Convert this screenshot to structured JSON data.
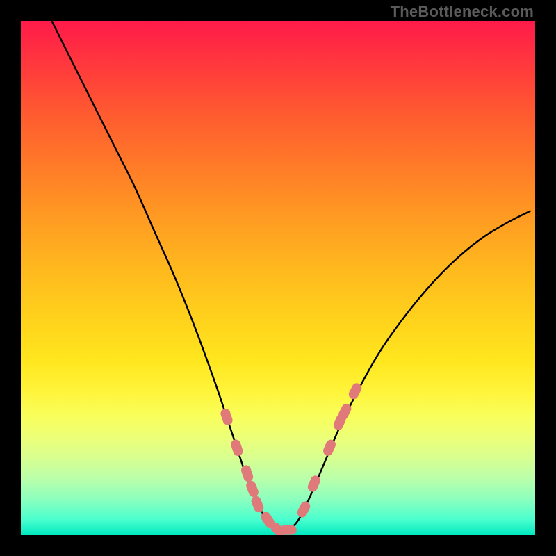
{
  "watermark": "TheBottleneck.com",
  "chart_data": {
    "type": "line",
    "title": "",
    "xlabel": "",
    "ylabel": "",
    "xlim": [
      0,
      100
    ],
    "ylim": [
      0,
      100
    ],
    "series": [
      {
        "name": "bottleneck-curve",
        "x": [
          6,
          10,
          14,
          18,
          22,
          26,
          30,
          34,
          38,
          40,
          42,
          44,
          46,
          48,
          50,
          52,
          54,
          56,
          59,
          62,
          66,
          70,
          75,
          80,
          85,
          90,
          95,
          99
        ],
        "y": [
          100,
          92,
          84,
          76,
          68,
          59,
          50,
          40,
          29,
          23,
          17,
          11,
          6,
          3,
          1,
          1,
          3,
          7,
          14,
          21,
          29,
          36,
          43,
          49,
          54,
          58,
          61,
          63
        ]
      }
    ],
    "markers": [
      {
        "x": 40,
        "y": 23
      },
      {
        "x": 42,
        "y": 17
      },
      {
        "x": 44,
        "y": 12
      },
      {
        "x": 45,
        "y": 9
      },
      {
        "x": 46,
        "y": 6
      },
      {
        "x": 48,
        "y": 3
      },
      {
        "x": 50,
        "y": 1
      },
      {
        "x": 52,
        "y": 1
      },
      {
        "x": 55,
        "y": 5
      },
      {
        "x": 57,
        "y": 10
      },
      {
        "x": 60,
        "y": 17
      },
      {
        "x": 62,
        "y": 22
      },
      {
        "x": 63,
        "y": 24
      },
      {
        "x": 65,
        "y": 28
      }
    ],
    "colors": {
      "curve": "#000000",
      "marker_fill": "#e07a7a",
      "marker_stroke": "#c76060"
    }
  }
}
